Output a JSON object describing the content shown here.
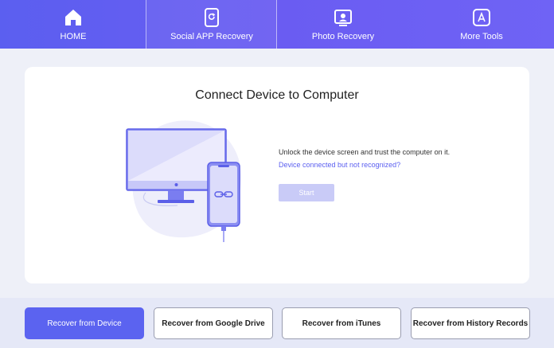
{
  "nav": {
    "items": [
      {
        "label": "HOME",
        "icon": "home-icon"
      },
      {
        "label": "Social APP Recovery",
        "icon": "phone-refresh-icon"
      },
      {
        "label": "Photo Recovery",
        "icon": "photo-monitor-icon"
      },
      {
        "label": "More Tools",
        "icon": "app-store-icon"
      }
    ],
    "active_index": 1
  },
  "main": {
    "title": "Connect Device to Computer",
    "instruction": "Unlock the device screen and trust the computer on it.",
    "help_link": "Device connected but not recognized?",
    "start_label": "Start"
  },
  "bottom": {
    "buttons": [
      {
        "label": "Recover from Device",
        "active": true
      },
      {
        "label": "Recover from Google Drive",
        "active": false
      },
      {
        "label": "Recover from iTunes",
        "active": false
      },
      {
        "label": "Recover from History Records",
        "active": false
      }
    ]
  },
  "colors": {
    "accent": "#5b5ff0",
    "nav_gradient_start": "#5b5ff0",
    "nav_gradient_end": "#6f63f5",
    "start_disabled": "#c9cbf7",
    "illustration": "#d8d9fb"
  }
}
